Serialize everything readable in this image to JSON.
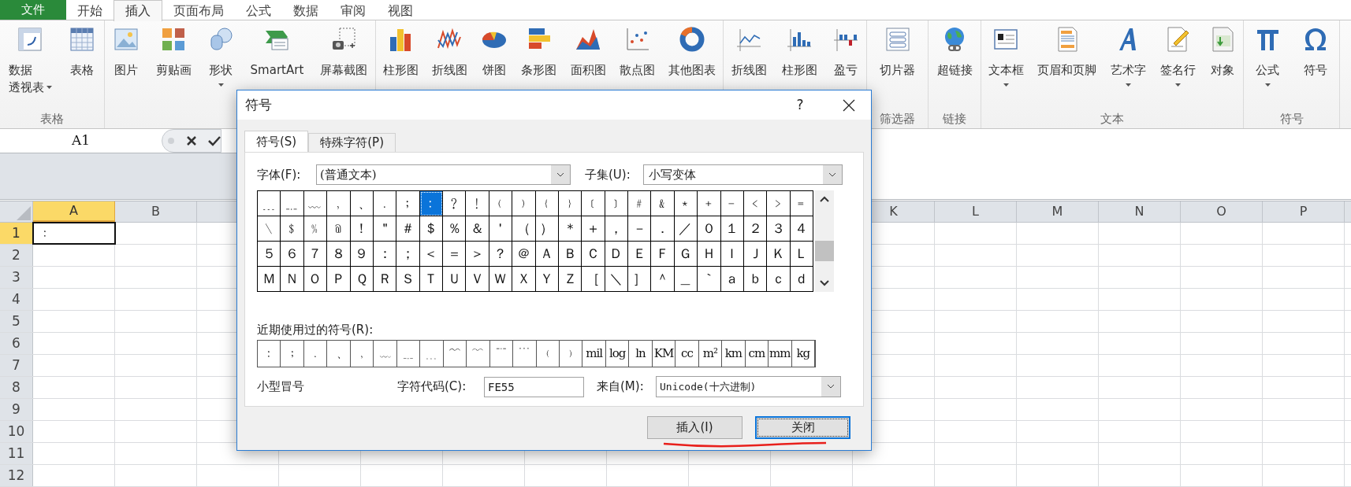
{
  "menu_tabs": [
    {
      "label": "文件",
      "kind": "file",
      "selected": false
    },
    {
      "label": "开始",
      "kind": "tab",
      "selected": false
    },
    {
      "label": "插入",
      "kind": "tab",
      "selected": true
    },
    {
      "label": "页面布局",
      "kind": "tab",
      "selected": false
    },
    {
      "label": "公式",
      "kind": "tab",
      "selected": false
    },
    {
      "label": "数据",
      "kind": "tab",
      "selected": false
    },
    {
      "label": "审阅",
      "kind": "tab",
      "selected": false
    },
    {
      "label": "视图",
      "kind": "tab",
      "selected": false
    }
  ],
  "ribbon_groups": [
    {
      "label": "表格",
      "items": [
        {
          "lines": [
            "数据",
            "透视表"
          ],
          "menu": true
        },
        {
          "lines": [
            "表格"
          ],
          "menu": false
        }
      ]
    },
    {
      "items": [
        {
          "lines": [
            "图片"
          ],
          "menu": false
        },
        {
          "lines": [
            "剪贴画"
          ],
          "menu": false
        },
        {
          "lines": [
            "形状"
          ],
          "menu": true
        },
        {
          "lines": [
            "SmartArt"
          ],
          "menu": false
        },
        {
          "lines": [
            "屏幕截图"
          ],
          "menu": false
        }
      ]
    },
    {
      "items": [
        {
          "lines": [
            "柱形图"
          ],
          "menu": false
        },
        {
          "lines": [
            "折线图"
          ],
          "menu": false
        },
        {
          "lines": [
            "饼图"
          ],
          "menu": false
        },
        {
          "lines": [
            "条形图"
          ],
          "menu": false
        },
        {
          "lines": [
            "面积图"
          ],
          "menu": false
        },
        {
          "lines": [
            "散点图"
          ],
          "menu": false
        },
        {
          "lines": [
            "其他图表"
          ],
          "menu": false
        }
      ]
    },
    {
      "items": [
        {
          "lines": [
            "折线图"
          ],
          "menu": false
        },
        {
          "lines": [
            "柱形图"
          ],
          "menu": false
        },
        {
          "lines": [
            "盈亏"
          ],
          "menu": false
        }
      ]
    },
    {
      "label": "筛选器",
      "items": [
        {
          "lines": [
            "切片器"
          ],
          "menu": false
        }
      ]
    },
    {
      "label": "链接",
      "items": [
        {
          "lines": [
            "超链接"
          ],
          "menu": false
        }
      ]
    },
    {
      "label": "文本",
      "items": [
        {
          "lines": [
            "文本框"
          ],
          "menu": true
        },
        {
          "lines": [
            "页眉和页脚"
          ],
          "menu": false
        },
        {
          "lines": [
            "艺术字"
          ],
          "menu": true
        },
        {
          "lines": [
            "签名行"
          ],
          "menu": true
        },
        {
          "lines": [
            "对象"
          ],
          "menu": false
        }
      ]
    },
    {
      "label": "符号",
      "items": [
        {
          "lines": [
            "公式"
          ],
          "menu": true
        },
        {
          "lines": [
            "符号"
          ],
          "menu": false
        }
      ]
    }
  ],
  "name_box": "A1",
  "sheet": {
    "columns": [
      {
        "label": "A",
        "selected": true
      },
      {
        "label": "B",
        "selected": false
      },
      {
        "label": "K",
        "selected": false
      },
      {
        "label": "L",
        "selected": false
      },
      {
        "label": "M",
        "selected": false
      },
      {
        "label": "N",
        "selected": false
      },
      {
        "label": "O",
        "selected": false
      },
      {
        "label": "P",
        "selected": false
      }
    ],
    "rows": [
      {
        "label": "1",
        "selected": true,
        "value": "﹕"
      },
      {
        "label": "2",
        "selected": false
      },
      {
        "label": "3",
        "selected": false
      },
      {
        "label": "4",
        "selected": false
      },
      {
        "label": "5",
        "selected": false
      },
      {
        "label": "6",
        "selected": false
      },
      {
        "label": "7",
        "selected": false
      },
      {
        "label": "8",
        "selected": false
      },
      {
        "label": "9",
        "selected": false
      },
      {
        "label": "10",
        "selected": false
      },
      {
        "label": "11",
        "selected": false
      },
      {
        "label": "12",
        "selected": false
      }
    ]
  },
  "dialog": {
    "title": "符号",
    "help": "?",
    "tabs": [
      {
        "label": "符号(S)",
        "selected": true
      },
      {
        "label": "特殊字符(P)",
        "selected": false
      }
    ],
    "font_label": "字体(F):",
    "font_value": "(普通文本)",
    "subset_label": "子集(U):",
    "subset_value": "小写变体",
    "grid": [
      [
        {
          "char": "﹍",
          "selected": false
        },
        {
          "char": "﹎",
          "selected": false
        },
        {
          "char": "﹏",
          "selected": false
        },
        {
          "char": "﹐",
          "selected": false
        },
        {
          "char": "﹑",
          "selected": false
        },
        {
          "char": "﹒",
          "selected": false
        },
        {
          "char": "﹔",
          "selected": false
        },
        {
          "char": "﹕",
          "selected": true
        },
        {
          "char": "﹖",
          "selected": false
        },
        {
          "char": "﹗",
          "selected": false
        },
        {
          "char": "﹙",
          "selected": false
        },
        {
          "char": "﹚",
          "selected": false
        },
        {
          "char": "﹛",
          "selected": false
        },
        {
          "char": "﹜",
          "selected": false
        },
        {
          "char": "﹝",
          "selected": false
        },
        {
          "char": "﹞",
          "selected": false
        },
        {
          "char": "﹟",
          "selected": false
        },
        {
          "char": "﹠",
          "selected": false
        },
        {
          "char": "﹡",
          "selected": false
        },
        {
          "char": "﹢",
          "selected": false
        },
        {
          "char": "﹣",
          "selected": false
        },
        {
          "char": "﹤",
          "selected": false
        },
        {
          "char": "﹥",
          "selected": false
        },
        {
          "char": "﹦",
          "selected": false
        }
      ],
      [
        {
          "char": "﹨",
          "selected": false
        },
        {
          "char": "﹩",
          "selected": false
        },
        {
          "char": "﹪",
          "selected": false
        },
        {
          "char": "﹫",
          "selected": false
        },
        {
          "char": "！",
          "selected": false
        },
        {
          "char": "＂",
          "selected": false
        },
        {
          "char": "＃",
          "selected": false
        },
        {
          "char": "＄",
          "selected": false
        },
        {
          "char": "％",
          "selected": false
        },
        {
          "char": "＆",
          "selected": false
        },
        {
          "char": "＇",
          "selected": false
        },
        {
          "char": "（",
          "selected": false
        },
        {
          "char": "）",
          "selected": false
        },
        {
          "char": "＊",
          "selected": false
        },
        {
          "char": "＋",
          "selected": false
        },
        {
          "char": "，",
          "selected": false
        },
        {
          "char": "－",
          "selected": false
        },
        {
          "char": "．",
          "selected": false
        },
        {
          "char": "／",
          "selected": false
        },
        {
          "char": "０",
          "selected": false
        },
        {
          "char": "１",
          "selected": false
        },
        {
          "char": "２",
          "selected": false
        },
        {
          "char": "３",
          "selected": false
        },
        {
          "char": "４",
          "selected": false
        }
      ],
      [
        {
          "char": "５",
          "selected": false
        },
        {
          "char": "６",
          "selected": false
        },
        {
          "char": "７",
          "selected": false
        },
        {
          "char": "８",
          "selected": false
        },
        {
          "char": "９",
          "selected": false
        },
        {
          "char": "：",
          "selected": false
        },
        {
          "char": "；",
          "selected": false
        },
        {
          "char": "＜",
          "selected": false
        },
        {
          "char": "＝",
          "selected": false
        },
        {
          "char": "＞",
          "selected": false
        },
        {
          "char": "？",
          "selected": false
        },
        {
          "char": "＠",
          "selected": false
        },
        {
          "char": "Ａ",
          "selected": false
        },
        {
          "char": "Ｂ",
          "selected": false
        },
        {
          "char": "Ｃ",
          "selected": false
        },
        {
          "char": "Ｄ",
          "selected": false
        },
        {
          "char": "Ｅ",
          "selected": false
        },
        {
          "char": "Ｆ",
          "selected": false
        },
        {
          "char": "Ｇ",
          "selected": false
        },
        {
          "char": "Ｈ",
          "selected": false
        },
        {
          "char": "Ｉ",
          "selected": false
        },
        {
          "char": "Ｊ",
          "selected": false
        },
        {
          "char": "Ｋ",
          "selected": false
        },
        {
          "char": "Ｌ",
          "selected": false
        }
      ],
      [
        {
          "char": "Ｍ",
          "selected": false
        },
        {
          "char": "Ｎ",
          "selected": false
        },
        {
          "char": "Ｏ",
          "selected": false
        },
        {
          "char": "Ｐ",
          "selected": false
        },
        {
          "char": "Ｑ",
          "selected": false
        },
        {
          "char": "Ｒ",
          "selected": false
        },
        {
          "char": "Ｓ",
          "selected": false
        },
        {
          "char": "Ｔ",
          "selected": false
        },
        {
          "char": "Ｕ",
          "selected": false
        },
        {
          "char": "Ｖ",
          "selected": false
        },
        {
          "char": "Ｗ",
          "selected": false
        },
        {
          "char": "Ｘ",
          "selected": false
        },
        {
          "char": "Ｙ",
          "selected": false
        },
        {
          "char": "Ｚ",
          "selected": false
        },
        {
          "char": "［",
          "selected": false
        },
        {
          "char": "＼",
          "selected": false
        },
        {
          "char": "］",
          "selected": false
        },
        {
          "char": "＾",
          "selected": false
        },
        {
          "char": "＿",
          "selected": false
        },
        {
          "char": "｀",
          "selected": false
        },
        {
          "char": "ａ",
          "selected": false
        },
        {
          "char": "ｂ",
          "selected": false
        },
        {
          "char": "ｃ",
          "selected": false
        },
        {
          "char": "ｄ",
          "selected": false
        }
      ]
    ],
    "recent_label": "近期使用过的符号(R):",
    "recent": [
      "﹕",
      "﹔",
      "﹒",
      "﹑",
      "﹐",
      "﹏",
      "﹎",
      "﹍",
      "﹌",
      "﹋",
      "﹊",
      "﹉",
      "﹙",
      "﹚",
      "mil",
      "log",
      "ln",
      "KM",
      "cc",
      "m²",
      "km",
      "cm",
      "mm",
      "kg"
    ],
    "char_name": "小型冒号",
    "code_label": "字符代码(C):",
    "code_value": "FE55",
    "from_label": "来自(M):",
    "from_value": "Unicode(十六进制)",
    "buttons": [
      {
        "label": "插入(I)",
        "default": false
      },
      {
        "label": "关闭",
        "default": true
      }
    ]
  }
}
